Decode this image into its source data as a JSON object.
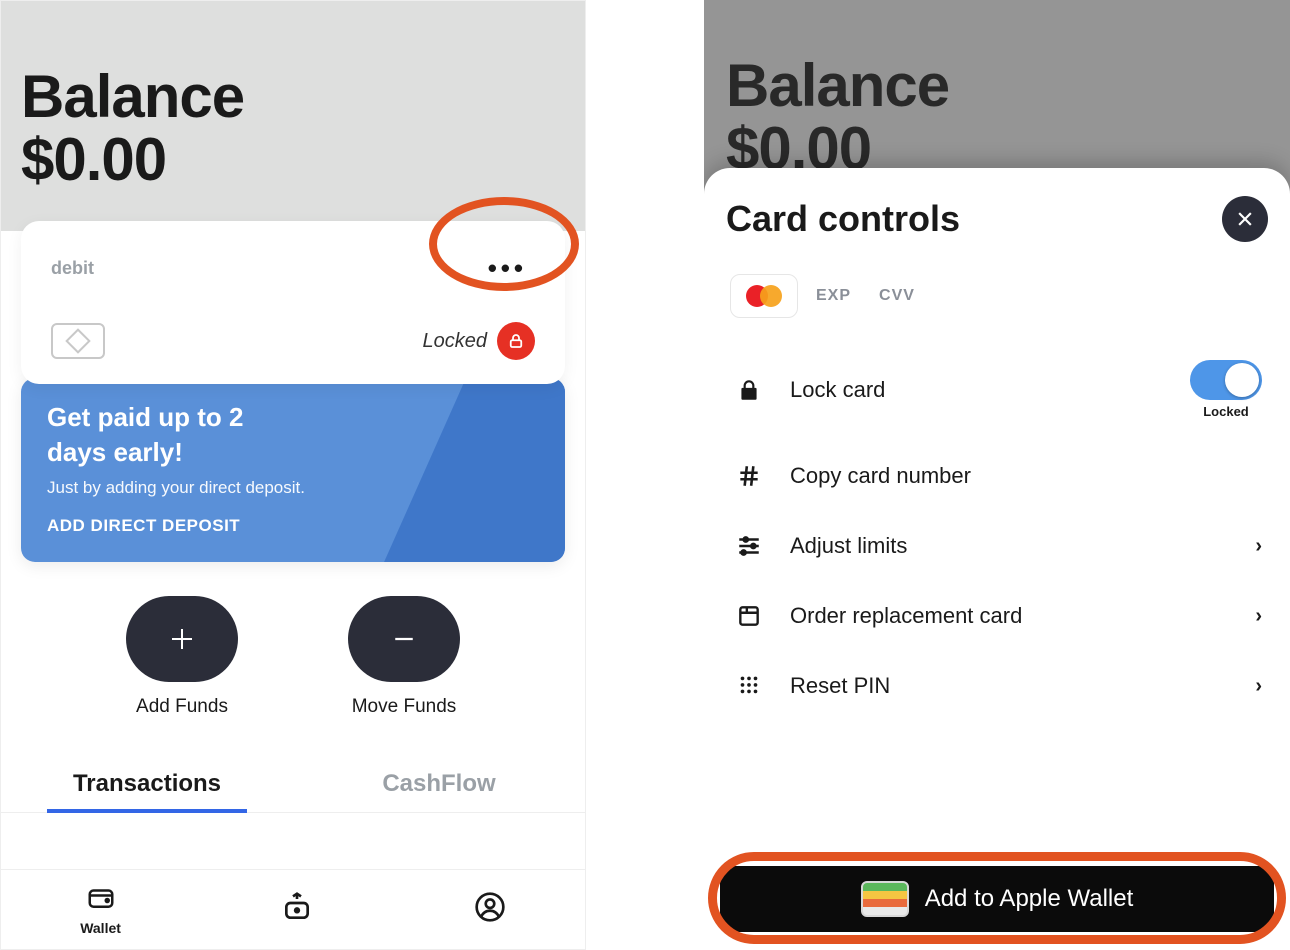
{
  "left": {
    "balance_label": "Balance",
    "balance_amount": "$0.00",
    "card": {
      "type_label": "debit",
      "locked_label": "Locked"
    },
    "promo": {
      "title": "Get paid up to 2 days early!",
      "subtitle": "Just by adding your direct deposit.",
      "cta": "ADD DIRECT DEPOSIT"
    },
    "actions": {
      "add_label": "Add Funds",
      "move_label": "Move Funds"
    },
    "tabs": {
      "transactions": "Transactions",
      "cashflow": "CashFlow"
    },
    "nav": {
      "wallet": "Wallet"
    }
  },
  "right": {
    "balance_label": "Balance",
    "balance_amount": "$0.00",
    "sheet_title": "Card controls",
    "card_meta": {
      "exp_label": "EXP",
      "cvv_label": "CVV"
    },
    "controls": {
      "lock": "Lock card",
      "lock_status": "Locked",
      "copy": "Copy card number",
      "limits": "Adjust limits",
      "replace": "Order replacement card",
      "pin": "Reset PIN"
    },
    "apple_wallet": "Add to Apple Wallet"
  }
}
